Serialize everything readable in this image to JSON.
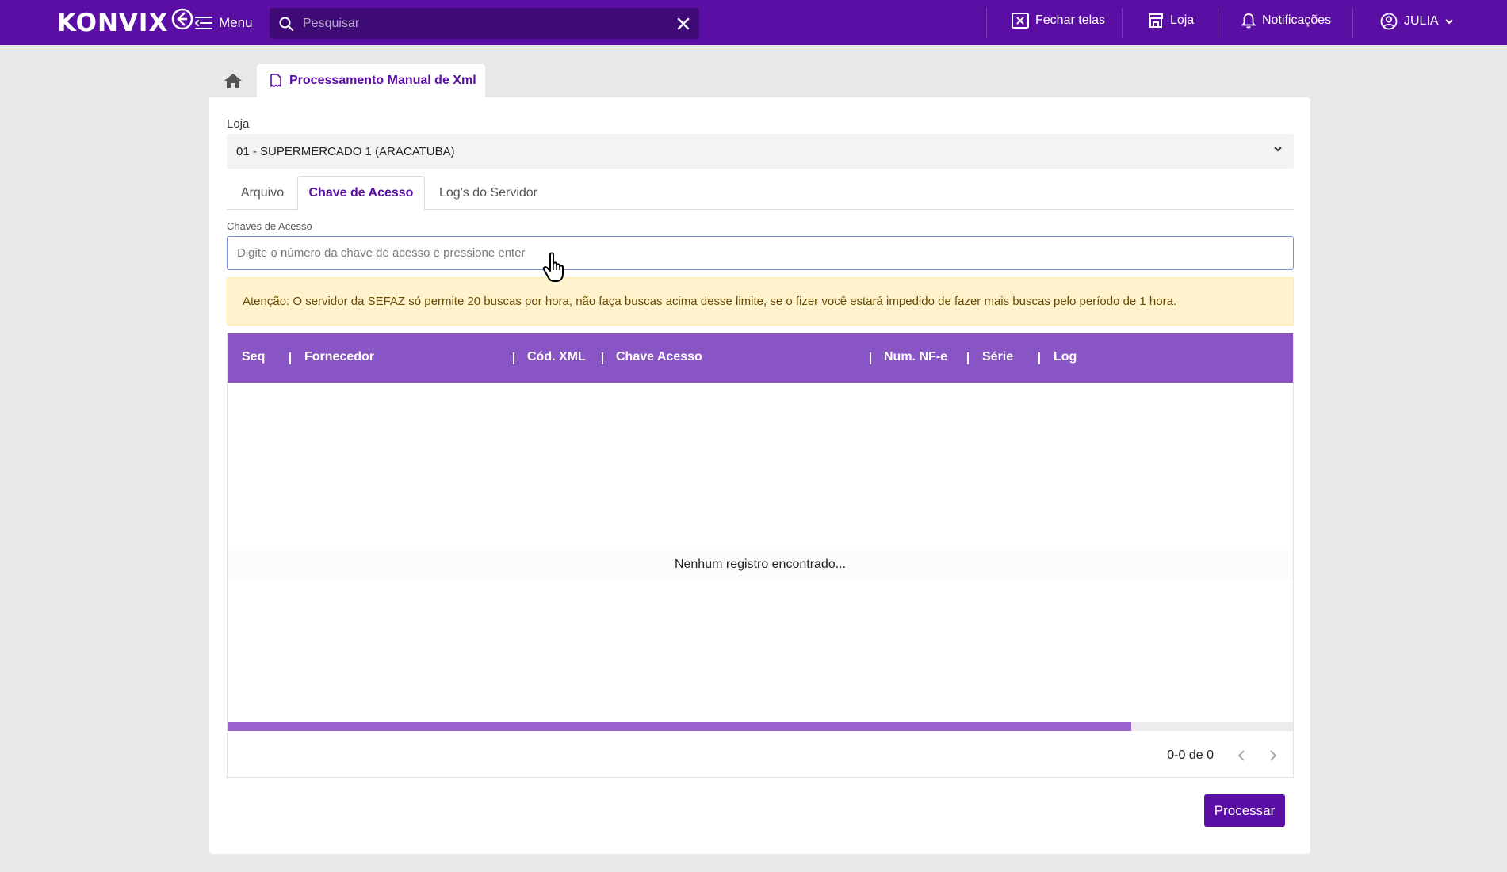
{
  "topbar": {
    "logo_text": "KONVIX",
    "menu_label": "Menu",
    "search_placeholder": "Pesquisar",
    "close_screens_label": "Fechar telas",
    "store_label": "Loja",
    "notifications_label": "Notificações",
    "user_label": "JULIA"
  },
  "breadcrumb": {
    "page_tab_label": "Processamento Manual de Xml"
  },
  "form": {
    "store_label": "Loja",
    "store_value": "01 - SUPERMERCADO 1 (ARACATUBA)",
    "tabs": [
      {
        "label": "Arquivo"
      },
      {
        "label": "Chave de Acesso"
      },
      {
        "label": "Log's do Servidor"
      }
    ],
    "keys_label": "Chaves de Acesso",
    "keys_placeholder": "Digite o número da chave de acesso e pressione enter",
    "alert_text": "Atenção: O servidor da SEFAZ só permite 20 buscas por hora, não faça buscas acima desse limite, se o fizer você estará impedido de fazer mais buscas pelo período de 1 hora."
  },
  "grid": {
    "columns": [
      {
        "label": "Seq"
      },
      {
        "label": "Fornecedor"
      },
      {
        "label": "Cód. XML"
      },
      {
        "label": "Chave Acesso"
      },
      {
        "label": "Num. NF-e"
      },
      {
        "label": "Série"
      },
      {
        "label": "Log"
      }
    ],
    "empty_text": "Nenhum registro encontrado...",
    "pager_text": "0-0 de 0"
  },
  "actions": {
    "process_label": "Processar"
  },
  "colors": {
    "brand": "#5a0ea3",
    "grid_header": "#8955c4",
    "alert_bg": "#fff3cd"
  }
}
